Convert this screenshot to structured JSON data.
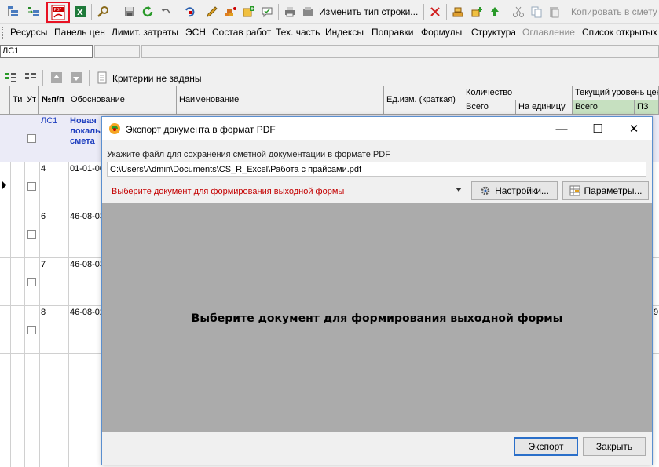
{
  "toolbar": {
    "change_row_type_label": "Изменить тип строки...",
    "copy_to_estimate_label": "Копировать в смету"
  },
  "menu": {
    "items": [
      {
        "label": "Ресурсы"
      },
      {
        "label": "Панель цен"
      },
      {
        "label": "Лимит. затраты"
      },
      {
        "label": "ЭСН"
      },
      {
        "label": "Состав работ"
      },
      {
        "label": "Тех. часть"
      },
      {
        "label": "Индексы"
      },
      {
        "label": "Поправки"
      },
      {
        "label": "Формулы"
      },
      {
        "label": "Структура"
      },
      {
        "label": "Оглавление"
      },
      {
        "label": "Список открытых"
      }
    ]
  },
  "name_field": {
    "value": "ЛС1"
  },
  "filter": {
    "criteria_label": "Критерии не заданы"
  },
  "grid": {
    "headers": {
      "ti": "Ти",
      "ut": "Ут",
      "num": "№п/п",
      "basis": "Обоснование",
      "name": "Наименование",
      "unit": "Ед.изм. (краткая)",
      "quantity": "Количество",
      "qty_total": "Всего",
      "qty_per_unit": "На единицу",
      "current_level": "Текущий уровень цен",
      "cur_total": "Всего",
      "cur_pz": "ПЗ"
    },
    "rows": [
      {
        "num": "ЛС1",
        "basis": "Новая локаль смета"
      },
      {
        "num": "4",
        "basis": "01-01-00"
      },
      {
        "num": "6",
        "basis": "46-08-03"
      },
      {
        "num": "7",
        "basis": "46-08-03"
      },
      {
        "num": "8",
        "basis": "46-08-02",
        "right_value": "9"
      }
    ]
  },
  "dialog": {
    "title": "Экспорт документа в формат PDF",
    "file_label": "Укажите файл для сохранения сметной документации в формате PDF",
    "file_path": "C:\\Users\\Admin\\Documents\\CS_R_Excel\\Работа с прайсами.pdf",
    "document_select_value": "Выберите документ для формирования выходной формы",
    "settings_button": "Настройки...",
    "params_button": "Параметры...",
    "preview_message": "Выберите документ для формирования выходной формы",
    "export_button": "Экспорт",
    "close_button": "Закрыть",
    "minimize_glyph": "—",
    "maximize_glyph": "☐",
    "close_glyph": "✕"
  },
  "colors": {
    "highlight_border": "#e81123",
    "accent_blue": "#1f5fbf",
    "select_text": "#c40000",
    "preview_bg": "#ababab"
  }
}
